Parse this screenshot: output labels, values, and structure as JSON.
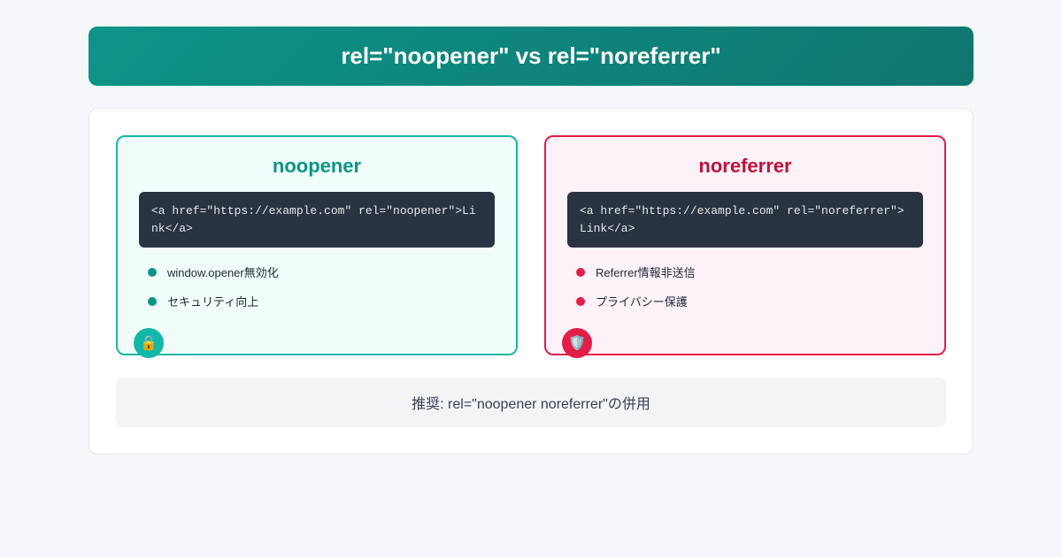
{
  "header": {
    "title": "rel=\"noopener\" vs rel=\"noreferrer\""
  },
  "cards": {
    "noopener": {
      "title": "noopener",
      "code": "<a href=\"https://example.com\" rel=\"noopener\">Link</a>",
      "features": [
        "window.opener無効化",
        "セキュリティ向上"
      ],
      "icon": "🔒"
    },
    "noreferrer": {
      "title": "noreferrer",
      "code": "<a href=\"https://example.com\" rel=\"noreferrer\">Link</a>",
      "features": [
        "Referrer情報非送信",
        "プライバシー保護"
      ],
      "icon": "🛡️"
    }
  },
  "footer": {
    "note": "推奨: rel=\"noopener noreferrer\"の併用"
  },
  "colors": {
    "noopener_accent": "#14b8a6",
    "noreferrer_accent": "#e11d48"
  }
}
